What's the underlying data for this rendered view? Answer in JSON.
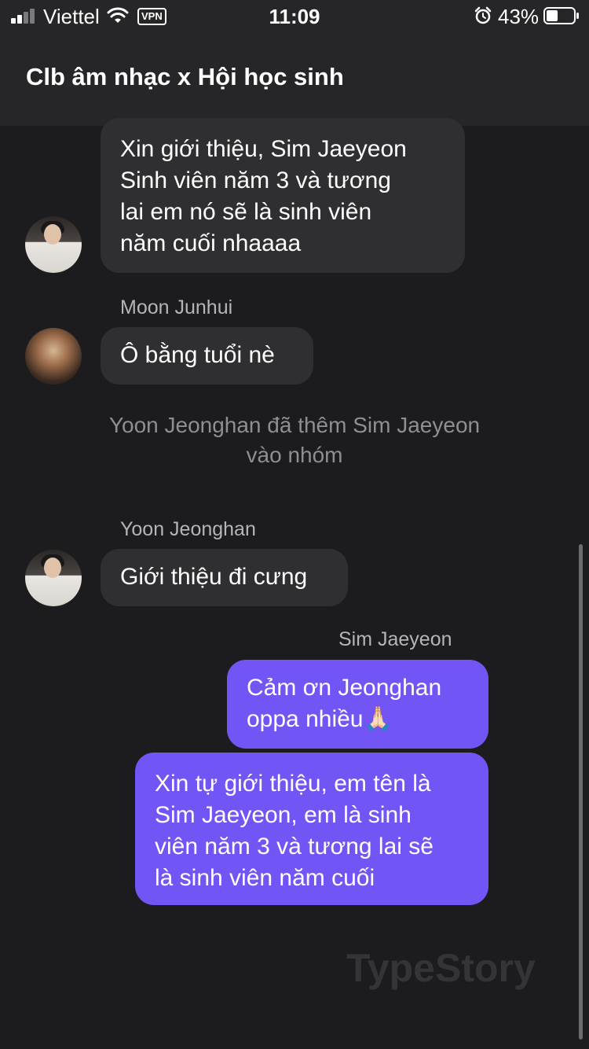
{
  "status_bar": {
    "carrier": "Viettel",
    "vpn": "VPN",
    "time": "11:09",
    "battery_percent": "43%",
    "battery_level": 0.43
  },
  "header": {
    "title": "Clb âm nhạc x Hội học sinh"
  },
  "messages": [
    {
      "type": "incoming",
      "text": "Xin giới thiệu, Sim Jaeyeon\nSinh viên năm 3 và tương\nlai em nó sẽ là sinh viên\nnăm cuối nhaaaa"
    },
    {
      "type": "incoming",
      "sender": "Moon Junhui",
      "text": "Ô bằng tuổi nè"
    },
    {
      "type": "system",
      "text": "Yoon Jeonghan đã thêm Sim Jaeyeon\nvào nhóm"
    },
    {
      "type": "incoming",
      "sender": "Yoon Jeonghan",
      "text": "Giới thiệu đi cưng"
    },
    {
      "type": "outgoing",
      "sender": "Sim Jaeyeon",
      "text": "Cảm ơn Jeonghan\noppa nhiều🙏🏻"
    },
    {
      "type": "outgoing",
      "text": "Xin tự giới thiệu, em tên là\nSim Jaeyeon, em là sinh\nviên năm 3 và tương lai sẽ\nlà sinh viên năm cuối"
    }
  ],
  "watermark": "TypeStory",
  "colors": {
    "background": "#1c1c1e",
    "header": "#262628",
    "incoming_bubble": "#2f2f31",
    "outgoing_bubble": "#7255f4",
    "secondary_text": "#b5b5b9"
  },
  "icons": [
    "signal-icon",
    "wifi-icon",
    "alarm-icon",
    "battery-icon"
  ]
}
